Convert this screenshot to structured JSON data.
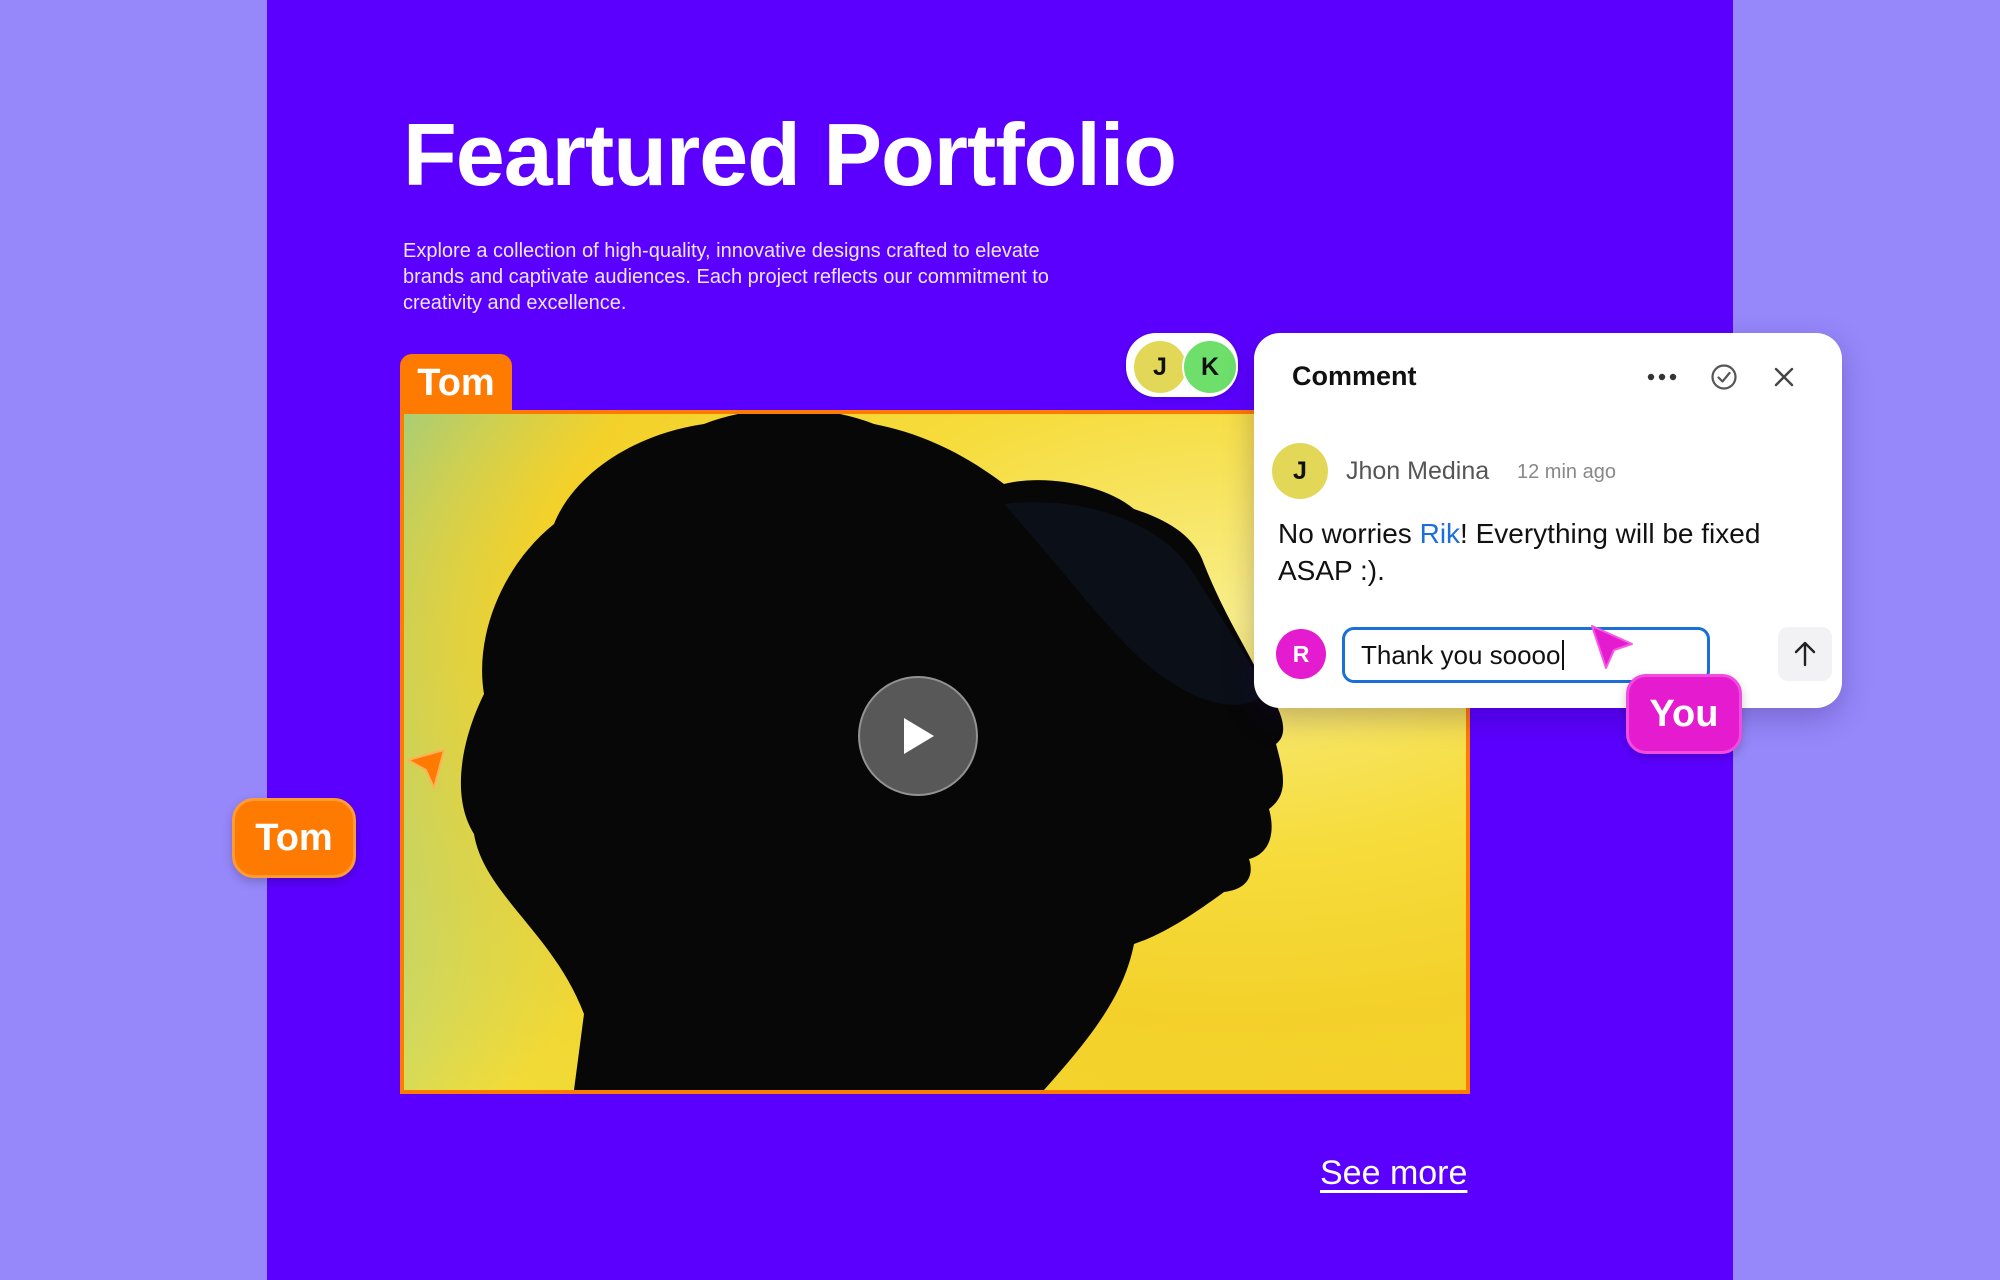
{
  "page": {
    "title": "Feartured Portfolio",
    "subtitle": "Explore a collection of high-quality, innovative designs crafted to elevate brands and captivate audiences. Each project reflects our commitment to creativity and excellence.",
    "see_more": "See more"
  },
  "media": {
    "frame_tag": "Tom",
    "play_icon": "play-icon"
  },
  "collaborators": {
    "avatars": [
      {
        "initial": "J",
        "color": "#e3d758"
      },
      {
        "initial": "K",
        "color": "#6ddf6a"
      }
    ],
    "cursor_tom": {
      "label": "Tom",
      "color": "#ff7a00"
    },
    "cursor_you": {
      "label": "You",
      "color": "#e51bd0"
    }
  },
  "comment": {
    "title": "Comment",
    "menu_icon": "more-horizontal-icon",
    "resolve_icon": "check-circle-icon",
    "close_icon": "close-icon",
    "author": {
      "initial": "J",
      "name": "Jhon Medina",
      "time": "12 min ago"
    },
    "body_before": "No worries ",
    "mention": "Rik",
    "body_after": "! Everything will be fixed ASAP :).",
    "reply": {
      "initial": "R",
      "value": "Thank you soooo",
      "send_icon": "arrow-up-icon"
    }
  }
}
